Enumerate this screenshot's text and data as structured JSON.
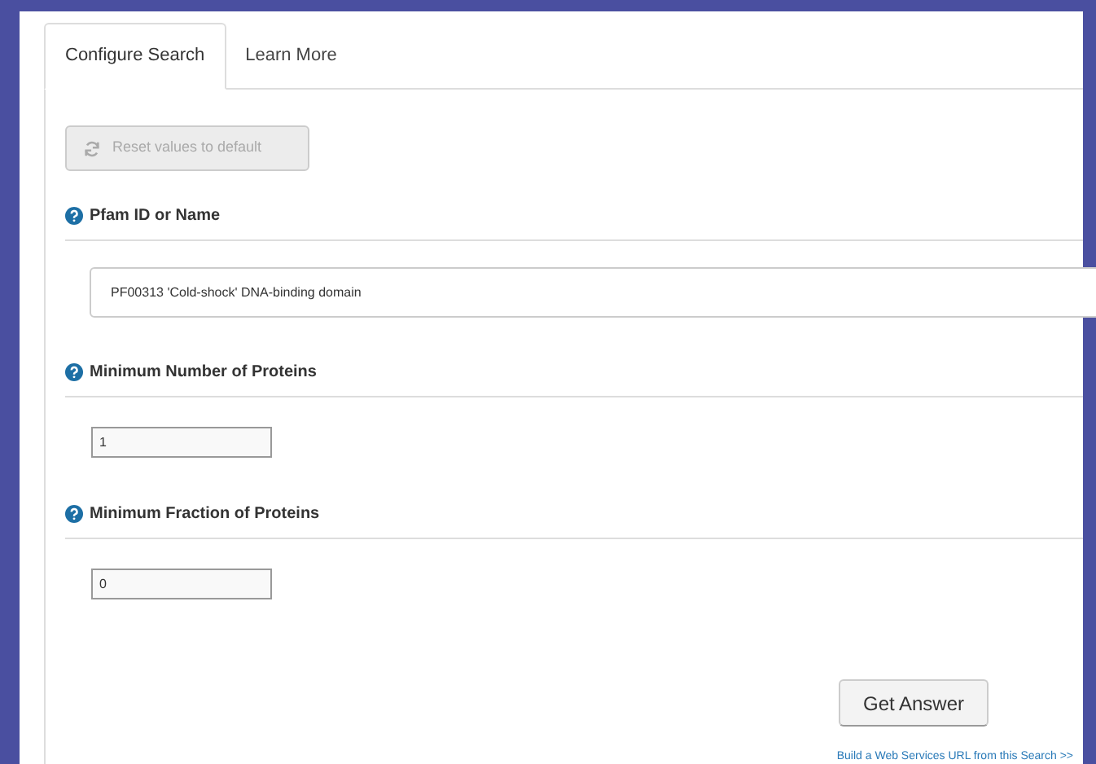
{
  "tabs": [
    {
      "label": "Configure Search",
      "selected": true
    },
    {
      "label": "Learn More",
      "selected": false
    }
  ],
  "reset_button": {
    "label": "Reset values to default",
    "disabled": true
  },
  "params": [
    {
      "label": "Pfam ID or Name",
      "kind": "wide",
      "value": "PF00313 'Cold-shock' DNA-binding domain"
    },
    {
      "label": "Minimum Number of Proteins",
      "kind": "short",
      "value": "1"
    },
    {
      "label": "Minimum Fraction of Proteins",
      "kind": "short",
      "value": "0"
    }
  ],
  "submit_button": "Get Answer",
  "web_services_link": "Build a Web Services URL from this Search >>"
}
